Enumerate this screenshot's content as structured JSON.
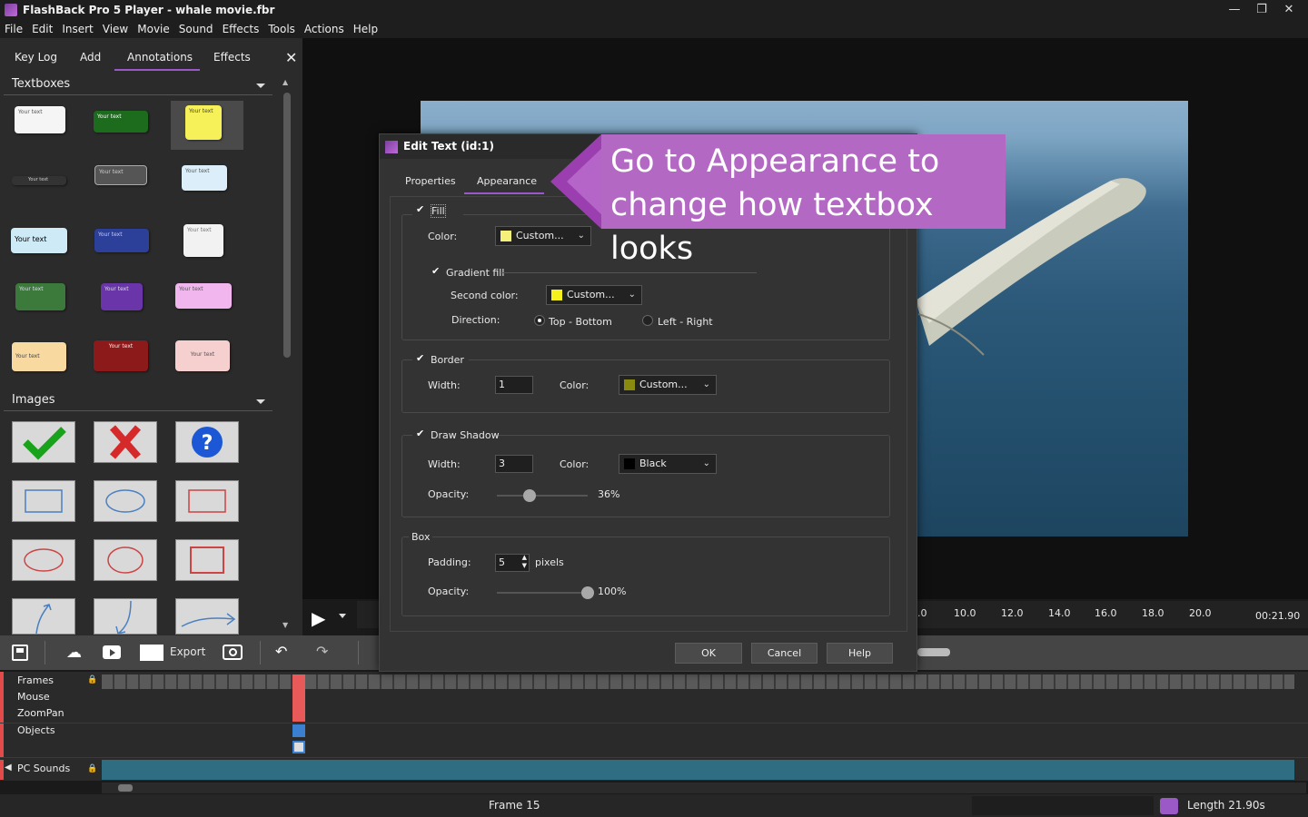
{
  "window": {
    "title": "FlashBack Pro 5 Player - whale movie.fbr"
  },
  "menu": [
    "File",
    "Edit",
    "Insert",
    "View",
    "Movie",
    "Sound",
    "Effects",
    "Tools",
    "Actions",
    "Help"
  ],
  "left_tabs": [
    "Key Log",
    "Add",
    "Annotations",
    "Effects"
  ],
  "sections": {
    "textboxes": "Textboxes",
    "images": "Images"
  },
  "textbox_samples": [
    "Your text",
    "Your text",
    "Your text",
    "Your text",
    "Your text",
    "Your text",
    "Your text",
    "Your text",
    "Your text",
    "Your text",
    "Your text",
    "Your text",
    "Your text",
    "Your text",
    "Your text"
  ],
  "dialog": {
    "title": "Edit Text (id:1)",
    "tabs": [
      "Properties",
      "Appearance"
    ],
    "fill": {
      "label": "Fill",
      "color_label": "Color:",
      "color_value": "Custom...",
      "color_hex": "#f4f07a"
    },
    "gradient": {
      "label": "Gradient fill",
      "second_color_label": "Second color:",
      "second_color_value": "Custom...",
      "second_color_hex": "#f6f01e",
      "direction_label": "Direction:",
      "opt1": "Top - Bottom",
      "opt2": "Left - Right"
    },
    "border": {
      "label": "Border",
      "width_label": "Width:",
      "width_value": "1",
      "color_label": "Color:",
      "color_value": "Custom...",
      "color_hex": "#8a8a10"
    },
    "shadow": {
      "label": "Draw Shadow",
      "width_label": "Width:",
      "width_value": "3",
      "color_label": "Color:",
      "color_value": "Black",
      "color_hex": "#000000",
      "opacity_label": "Opacity:",
      "opacity_value": "36%",
      "opacity": 0.36
    },
    "box": {
      "label": "Box",
      "padding_label": "Padding:",
      "padding_value": "5",
      "padding_unit": "pixels",
      "opacity_label": "Opacity:",
      "opacity_value": "100%",
      "opacity": 1.0
    },
    "buttons": {
      "ok": "OK",
      "cancel": "Cancel",
      "help": "Help"
    }
  },
  "callout": {
    "line1": "Go to Appearance to",
    "line2": "change how textbox looks"
  },
  "ruler": {
    "ticks": [
      ".0",
      "10.0",
      "12.0",
      "14.0",
      "16.0",
      "18.0",
      "20.0"
    ],
    "time": "00:21.90"
  },
  "toolbar": {
    "export": "Export"
  },
  "tracks": {
    "frames": "Frames",
    "mouse": "Mouse",
    "zoompan": "ZoomPan",
    "objects": "Objects",
    "sounds": "PC Sounds"
  },
  "status": {
    "frame": "Frame 15",
    "length": "Length 21.90s"
  }
}
